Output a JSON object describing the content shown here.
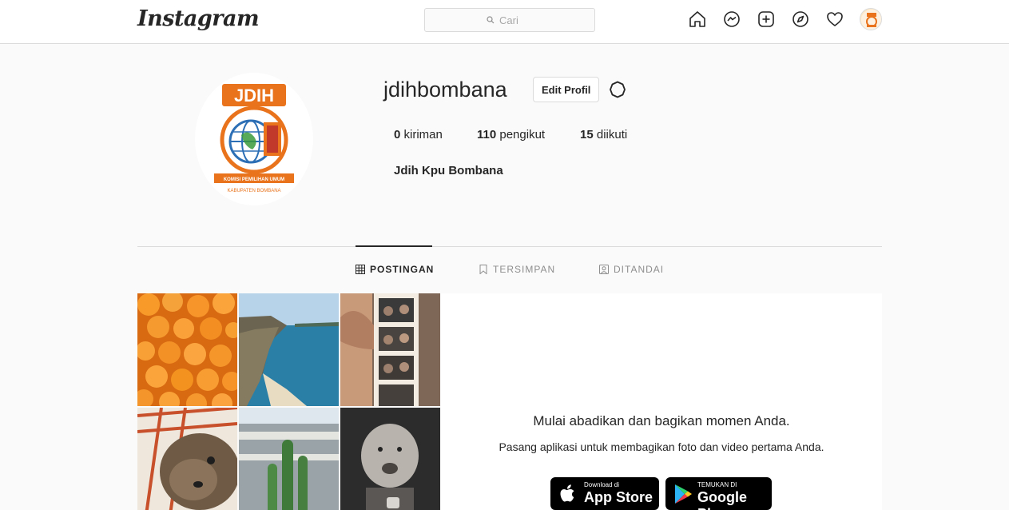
{
  "nav": {
    "logo": "Instagram",
    "search_placeholder": "Cari",
    "icons": [
      "home-icon",
      "messenger-icon",
      "new-post-icon",
      "explore-icon",
      "activity-heart-icon",
      "profile-avatar"
    ]
  },
  "profile": {
    "username": "jdihbombana",
    "edit_button": "Edit Profil",
    "stats": [
      {
        "count": "0",
        "label": "kiriman"
      },
      {
        "count": "110",
        "label": "pengikut"
      },
      {
        "count": "15",
        "label": "diikuti"
      }
    ],
    "full_name": "Jdih Kpu Bombana",
    "logo_text": {
      "top": "JDIH",
      "band": "KOMISI PEMILIHAN UMUM",
      "bottom": "KABUPATEN BOMBANA"
    }
  },
  "tabs": [
    {
      "label": "POSTINGAN",
      "active": true,
      "icon": "grid-icon"
    },
    {
      "label": "TERSIMPAN",
      "active": false,
      "icon": "bookmark-icon"
    },
    {
      "label": "DITANDAI",
      "active": false,
      "icon": "tagged-icon"
    }
  ],
  "promo": {
    "title": "Mulai abadikan dan bagikan momen Anda.",
    "subtitle": "Pasang aplikasi untuk membagikan foto dan video pertama Anda.",
    "app_store_small": "Download di",
    "app_store_big": "App Store",
    "google_play_small": "TEMUKAN DI",
    "google_play_big": "Google Play"
  },
  "colors": {
    "background": "#fafafa",
    "border": "#dbdbdb",
    "text": "#262626",
    "muted": "#8e8e8e",
    "logo_orange": "#e8731c"
  }
}
